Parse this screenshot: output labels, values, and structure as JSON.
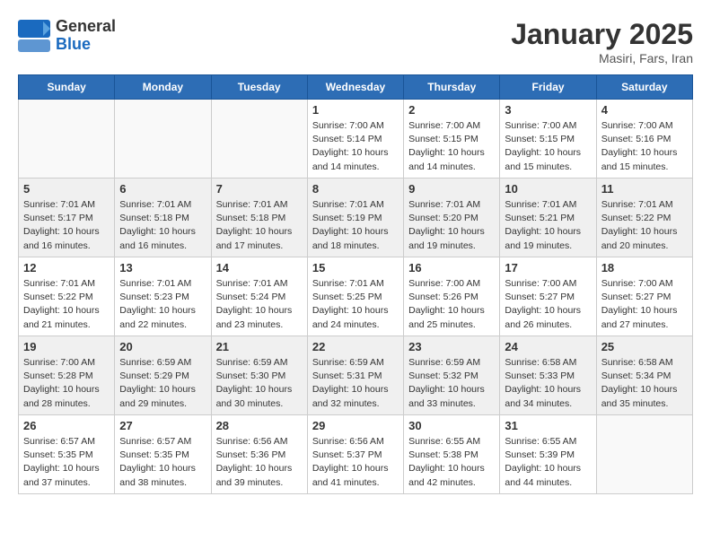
{
  "header": {
    "logo_general": "General",
    "logo_blue": "Blue",
    "month_title": "January 2025",
    "location": "Masiri, Fars, Iran"
  },
  "days_of_week": [
    "Sunday",
    "Monday",
    "Tuesday",
    "Wednesday",
    "Thursday",
    "Friday",
    "Saturday"
  ],
  "weeks": [
    {
      "days": [
        {
          "num": "",
          "info": "",
          "empty": true
        },
        {
          "num": "",
          "info": "",
          "empty": true
        },
        {
          "num": "",
          "info": "",
          "empty": true
        },
        {
          "num": "1",
          "info": "Sunrise: 7:00 AM\nSunset: 5:14 PM\nDaylight: 10 hours\nand 14 minutes."
        },
        {
          "num": "2",
          "info": "Sunrise: 7:00 AM\nSunset: 5:15 PM\nDaylight: 10 hours\nand 14 minutes."
        },
        {
          "num": "3",
          "info": "Sunrise: 7:00 AM\nSunset: 5:15 PM\nDaylight: 10 hours\nand 15 minutes."
        },
        {
          "num": "4",
          "info": "Sunrise: 7:00 AM\nSunset: 5:16 PM\nDaylight: 10 hours\nand 15 minutes."
        }
      ]
    },
    {
      "days": [
        {
          "num": "5",
          "info": "Sunrise: 7:01 AM\nSunset: 5:17 PM\nDaylight: 10 hours\nand 16 minutes."
        },
        {
          "num": "6",
          "info": "Sunrise: 7:01 AM\nSunset: 5:18 PM\nDaylight: 10 hours\nand 16 minutes."
        },
        {
          "num": "7",
          "info": "Sunrise: 7:01 AM\nSunset: 5:18 PM\nDaylight: 10 hours\nand 17 minutes."
        },
        {
          "num": "8",
          "info": "Sunrise: 7:01 AM\nSunset: 5:19 PM\nDaylight: 10 hours\nand 18 minutes."
        },
        {
          "num": "9",
          "info": "Sunrise: 7:01 AM\nSunset: 5:20 PM\nDaylight: 10 hours\nand 19 minutes."
        },
        {
          "num": "10",
          "info": "Sunrise: 7:01 AM\nSunset: 5:21 PM\nDaylight: 10 hours\nand 19 minutes."
        },
        {
          "num": "11",
          "info": "Sunrise: 7:01 AM\nSunset: 5:22 PM\nDaylight: 10 hours\nand 20 minutes."
        }
      ]
    },
    {
      "days": [
        {
          "num": "12",
          "info": "Sunrise: 7:01 AM\nSunset: 5:22 PM\nDaylight: 10 hours\nand 21 minutes."
        },
        {
          "num": "13",
          "info": "Sunrise: 7:01 AM\nSunset: 5:23 PM\nDaylight: 10 hours\nand 22 minutes."
        },
        {
          "num": "14",
          "info": "Sunrise: 7:01 AM\nSunset: 5:24 PM\nDaylight: 10 hours\nand 23 minutes."
        },
        {
          "num": "15",
          "info": "Sunrise: 7:01 AM\nSunset: 5:25 PM\nDaylight: 10 hours\nand 24 minutes."
        },
        {
          "num": "16",
          "info": "Sunrise: 7:00 AM\nSunset: 5:26 PM\nDaylight: 10 hours\nand 25 minutes."
        },
        {
          "num": "17",
          "info": "Sunrise: 7:00 AM\nSunset: 5:27 PM\nDaylight: 10 hours\nand 26 minutes."
        },
        {
          "num": "18",
          "info": "Sunrise: 7:00 AM\nSunset: 5:27 PM\nDaylight: 10 hours\nand 27 minutes."
        }
      ]
    },
    {
      "days": [
        {
          "num": "19",
          "info": "Sunrise: 7:00 AM\nSunset: 5:28 PM\nDaylight: 10 hours\nand 28 minutes."
        },
        {
          "num": "20",
          "info": "Sunrise: 6:59 AM\nSunset: 5:29 PM\nDaylight: 10 hours\nand 29 minutes."
        },
        {
          "num": "21",
          "info": "Sunrise: 6:59 AM\nSunset: 5:30 PM\nDaylight: 10 hours\nand 30 minutes."
        },
        {
          "num": "22",
          "info": "Sunrise: 6:59 AM\nSunset: 5:31 PM\nDaylight: 10 hours\nand 32 minutes."
        },
        {
          "num": "23",
          "info": "Sunrise: 6:59 AM\nSunset: 5:32 PM\nDaylight: 10 hours\nand 33 minutes."
        },
        {
          "num": "24",
          "info": "Sunrise: 6:58 AM\nSunset: 5:33 PM\nDaylight: 10 hours\nand 34 minutes."
        },
        {
          "num": "25",
          "info": "Sunrise: 6:58 AM\nSunset: 5:34 PM\nDaylight: 10 hours\nand 35 minutes."
        }
      ]
    },
    {
      "days": [
        {
          "num": "26",
          "info": "Sunrise: 6:57 AM\nSunset: 5:35 PM\nDaylight: 10 hours\nand 37 minutes."
        },
        {
          "num": "27",
          "info": "Sunrise: 6:57 AM\nSunset: 5:35 PM\nDaylight: 10 hours\nand 38 minutes."
        },
        {
          "num": "28",
          "info": "Sunrise: 6:56 AM\nSunset: 5:36 PM\nDaylight: 10 hours\nand 39 minutes."
        },
        {
          "num": "29",
          "info": "Sunrise: 6:56 AM\nSunset: 5:37 PM\nDaylight: 10 hours\nand 41 minutes."
        },
        {
          "num": "30",
          "info": "Sunrise: 6:55 AM\nSunset: 5:38 PM\nDaylight: 10 hours\nand 42 minutes."
        },
        {
          "num": "31",
          "info": "Sunrise: 6:55 AM\nSunset: 5:39 PM\nDaylight: 10 hours\nand 44 minutes."
        },
        {
          "num": "",
          "info": "",
          "empty": true
        }
      ]
    }
  ]
}
